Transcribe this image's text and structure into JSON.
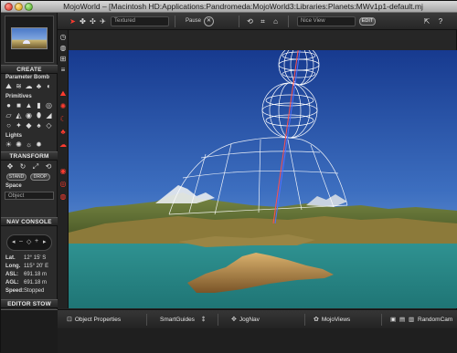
{
  "window": {
    "title": "MojoWorld – [Macintosh HD:Applications:Pandromeda:MojoWorld3:Libraries:Planets:MWv1p1-default.mj"
  },
  "toolbar": {
    "render_mode": "Textured",
    "pause_label": "Pause",
    "view_mode": "Nice View",
    "edit_label": "EDIT"
  },
  "left_panel": {
    "create_title": "CREATE",
    "parameter_bomb_label": "Parameter Bomb",
    "primitives_label": "Primitives",
    "lights_label": "Lights",
    "transform_title": "TRANSFORM",
    "stand_label": "STAND",
    "drop_label": "DROP",
    "space_label": "Space",
    "space_value": "Object",
    "nav_console_title": "NAV CONSOLE",
    "nav_minus": "–",
    "nav_plus": "+",
    "nav_info": [
      {
        "label": "Lat.",
        "value": "12° 15' S"
      },
      {
        "label": "Long.",
        "value": "115° 20' E"
      },
      {
        "label": "ASL:",
        "value": "691.18 m"
      },
      {
        "label": "AGL:",
        "value": "691.18 m"
      },
      {
        "label": "Speed:",
        "value": "Stopped"
      }
    ],
    "editor_stow_title": "EDITOR STOW"
  },
  "bottom_bar": {
    "object_properties": "Object Properties",
    "smart_guides": "SmartGuides",
    "jog_nav": "JogNav",
    "mojo_views": "MojoViews",
    "random_cam": "RandomCam"
  },
  "icons": {
    "cursor": "cursor-arrow-icon",
    "walk": "walk-icon",
    "run": "run-icon",
    "fly": "fly-icon"
  },
  "colors": {
    "accent_red": "#ff3b2f",
    "sky_top": "#1a3a8e",
    "sky_horizon": "#7aa5d9",
    "water": "#2a8a8a",
    "wireframe": "#ffffff"
  }
}
